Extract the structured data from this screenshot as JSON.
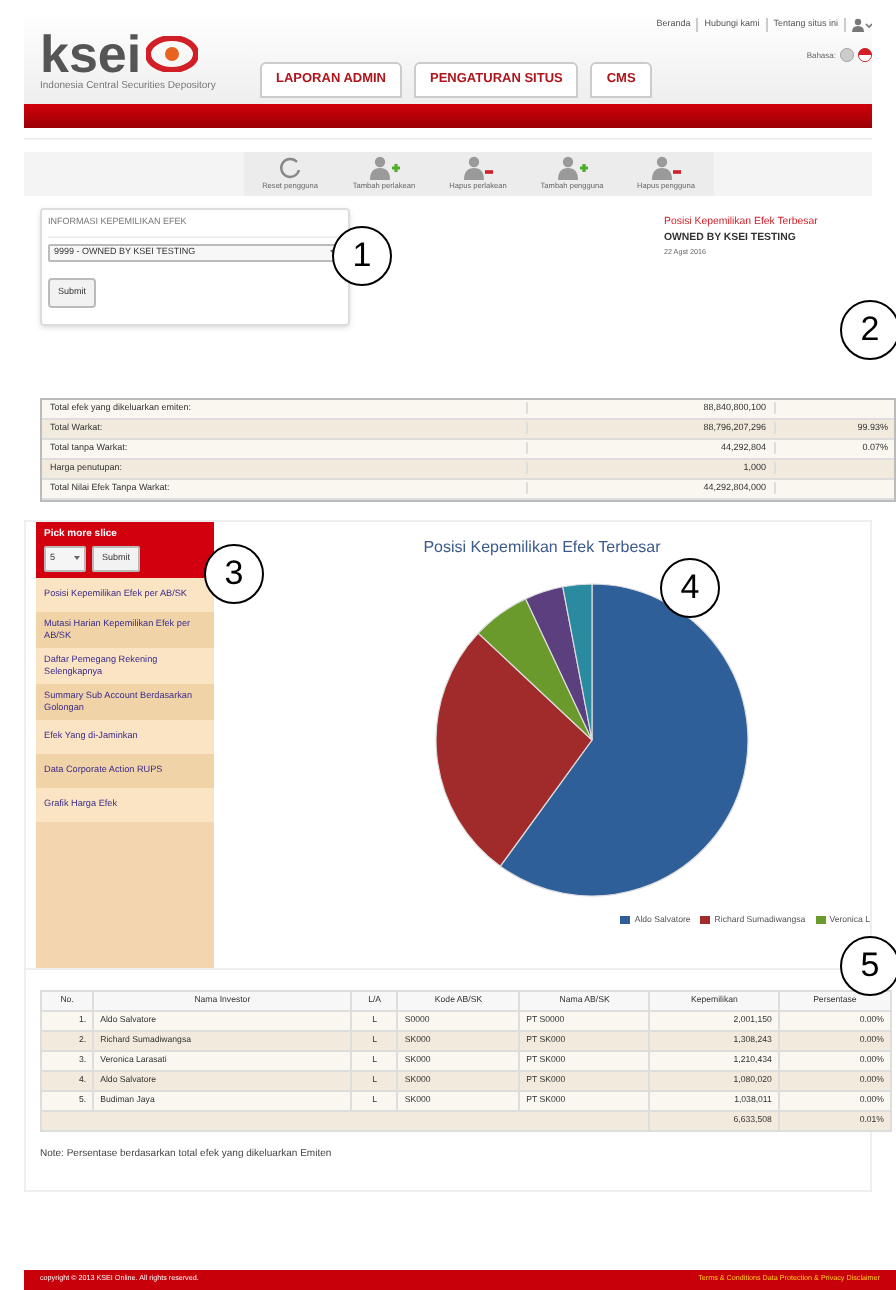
{
  "header": {
    "logo": "ksei",
    "logo_caption": "Indonesia Central Securities Depository",
    "tabs": [
      {
        "label": "LAPORAN ADMIN",
        "selected": false
      },
      {
        "label": "PENGATURAN SITUS",
        "selected": false
      },
      {
        "label": "CMS",
        "selected": false
      }
    ],
    "links": [
      "Beranda",
      "Hubungi kami",
      "Tentang situs ini"
    ],
    "language_label": "Bahasa:"
  },
  "toolbar": [
    {
      "label": "Reset pengguna",
      "kind": "reset"
    },
    {
      "label": "Tambah perlakean",
      "kind": "add-group"
    },
    {
      "label": "Hapus perlakean",
      "kind": "remove-group"
    },
    {
      "label": "Tambah pengguna",
      "kind": "add-user"
    },
    {
      "label": "Hapus pengguna",
      "kind": "remove-user"
    }
  ],
  "info": {
    "title": "INFORMASI KEPEMILIKAN EFEK",
    "select_value": "9999 - OWNED BY KSEI TESTING",
    "button": "Submit"
  },
  "summary": {
    "heading": "Posisi Kepemilikan Efek Terbesar",
    "owner": "OWNED BY KSEI TESTING",
    "date": "22 Agst 2016"
  },
  "totals": [
    {
      "label": "Total efek yang dikeluarkan emiten:",
      "value": "88,840,800,100"
    },
    {
      "label": "Total Warkat:",
      "value": "88,796,207,296",
      "percent": "99.93%"
    },
    {
      "label": "Total tanpa Warkat:",
      "value": "44,292,804",
      "percent": "0.07%"
    },
    {
      "label": "Harga penutupan:",
      "value": "1,000"
    },
    {
      "label": "Total Nilai Efek Tanpa Warkat:",
      "value": "44,292,804,000"
    }
  ],
  "sidebar": {
    "title": "Pick more slice",
    "select_value": "5",
    "button": "Submit",
    "items": [
      "Posisi Kepemilikan Efek per AB/SK",
      "Mutasi Harian Kepemilikan Efek per AB/SK",
      "Daftar Pemegang Rekening Selengkapnya",
      "Summary Sub Account Berdasarkan Golongan",
      "Efek Yang di-Jaminkan",
      "Data Corporate Action RUPS",
      "Grafik Harga Efek"
    ]
  },
  "chart": {
    "title": "Posisi Kepemilikan Efek Terbesar",
    "legend": [
      {
        "label": "Aldo Salvatore",
        "color": "#2e5f98"
      },
      {
        "label": "Richard Sumadiwangsa",
        "color": "#a12a2a"
      },
      {
        "label": "Veronica L",
        "color": "#6b9a2c"
      }
    ]
  },
  "table": {
    "columns": [
      "No.",
      "Nama Investor",
      "L/A",
      "Kode AB/SK",
      "Nama AB/SK",
      "Kepemilikan",
      "Persentase"
    ],
    "rows": [
      [
        "1.",
        "Aldo Salvatore",
        "L",
        "S0000",
        "PT S0000",
        "2,001,150",
        "0.00%"
      ],
      [
        "2.",
        "Richard Sumadiwangsa",
        "L",
        "SK000",
        "PT SK000",
        "1,308,243",
        "0.00%"
      ],
      [
        "3.",
        "Veronica Larasati",
        "L",
        "SK000",
        "PT SK000",
        "1,210,434",
        "0.00%"
      ],
      [
        "4.",
        "Aldo Salvatore",
        "L",
        "SK000",
        "PT SK000",
        "1,080,020",
        "0.00%"
      ],
      [
        "5.",
        "Budiman Jaya",
        "L",
        "SK000",
        "PT SK000",
        "1,038,011",
        "0.00%"
      ]
    ],
    "total": {
      "kepemilikan": "6,633,508",
      "persentase": "0.01%"
    }
  },
  "note": "Note: Persentase berdasarkan total efek yang dikeluarkan Emiten",
  "footer": {
    "copyright": "copyright © 2013 KSEI Online. All rights reserved.",
    "links": "Terms & Conditions Data Protection & Privacy Disclaimer"
  },
  "callouts": [
    "1",
    "2",
    "3",
    "4",
    "5"
  ]
}
